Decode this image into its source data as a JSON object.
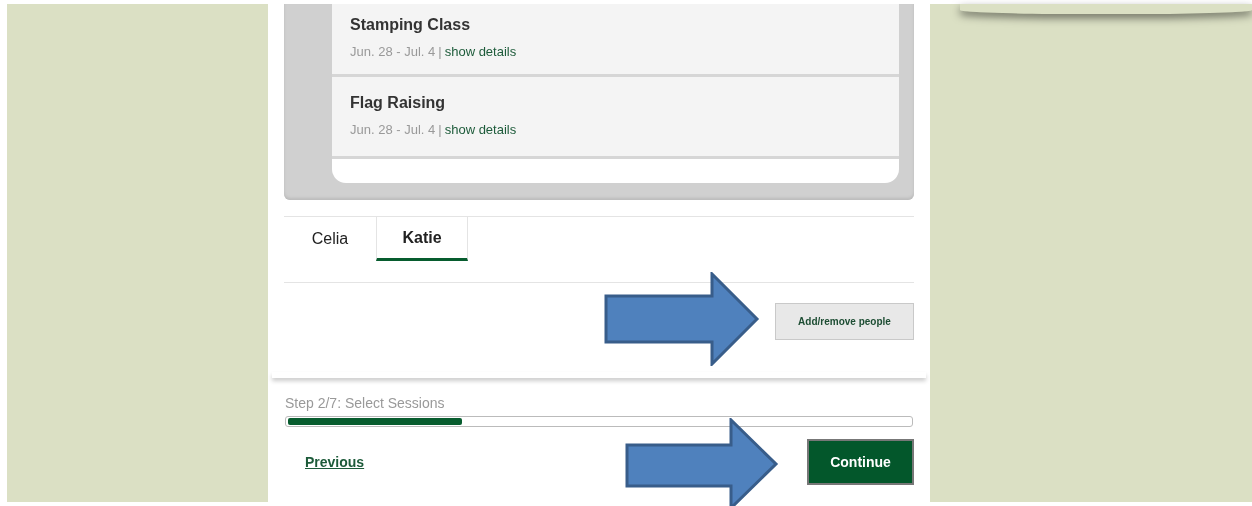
{
  "sessions": [
    {
      "title": "Stamping Class",
      "dates": "Jun. 28 - Jul. 4",
      "separator": "|",
      "link": "show details"
    },
    {
      "title": "Flag Raising",
      "dates": "Jun. 28 - Jul. 4",
      "separator": "|",
      "link": "show details"
    }
  ],
  "tabs": [
    {
      "label": "Celia",
      "selected": false
    },
    {
      "label": "Katie",
      "selected": true
    }
  ],
  "add_button": "Add/remove people",
  "progress": {
    "label": "Step 2/7: Select Sessions",
    "level": 0.28
  },
  "previous": "Previous",
  "continue": "Continue"
}
